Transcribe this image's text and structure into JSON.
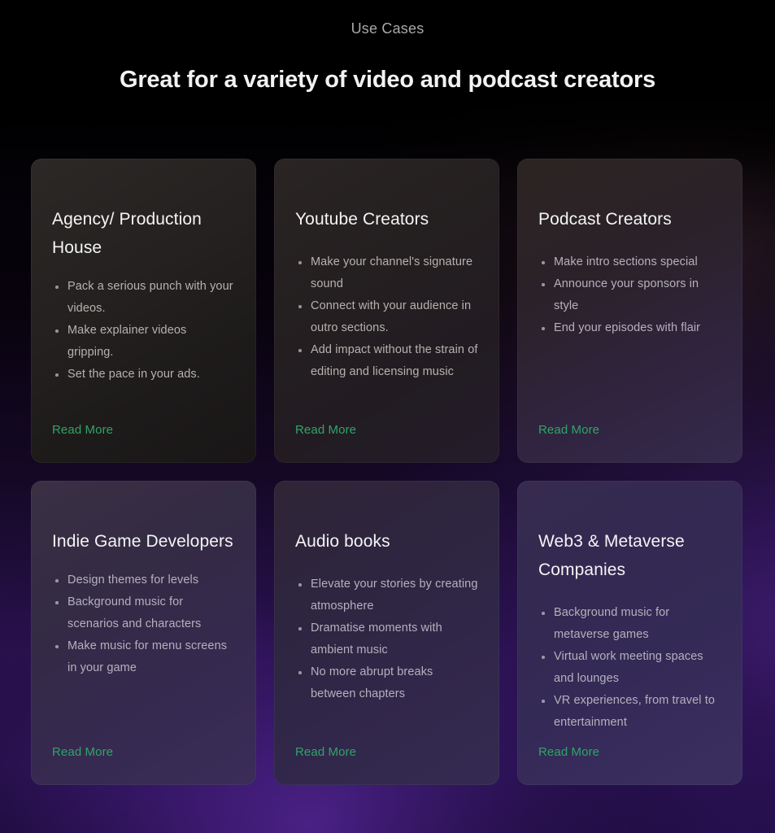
{
  "header": {
    "eyebrow": "Use Cases",
    "headline": "Great for a variety of video and podcast creators"
  },
  "theme": {
    "accent_green": "#2fa567",
    "heading_color": "#f2f2f2",
    "eyebrow_color": "#a9a9a9",
    "body_text_color": "#b7b2ae",
    "page_background": "#030104",
    "glow_purple": "#56269a"
  },
  "cards": [
    {
      "title": "Agency/ Production House",
      "bullets": [
        "Pack a serious punch with your videos.",
        "Make explainer videos gripping.",
        "Set the pace in your ads."
      ],
      "cta": "Read More"
    },
    {
      "title": "Youtube Creators",
      "bullets": [
        "Make your channel's signature sound",
        "Connect with your audience in outro sections.",
        "Add impact without the strain of editing and licensing music"
      ],
      "cta": "Read More"
    },
    {
      "title": "Podcast Creators",
      "bullets": [
        "Make intro sections special",
        "Announce your sponsors in style",
        "End your episodes with flair"
      ],
      "cta": "Read More"
    },
    {
      "title": "Indie Game Developers",
      "bullets": [
        "Design themes for levels",
        "Background music for scenarios and characters",
        "Make music for menu screens in your game"
      ],
      "cta": "Read More"
    },
    {
      "title": "Audio books",
      "bullets": [
        "Elevate your stories by creating atmosphere",
        "Dramatise moments with ambient music",
        "No more abrupt breaks between chapters"
      ],
      "cta": "Read More"
    },
    {
      "title": "Web3 & Metaverse Companies",
      "bullets": [
        "Background music for metaverse games",
        "Virtual work meeting spaces and lounges",
        "VR experiences, from travel to entertainment"
      ],
      "cta": "Read More"
    }
  ]
}
